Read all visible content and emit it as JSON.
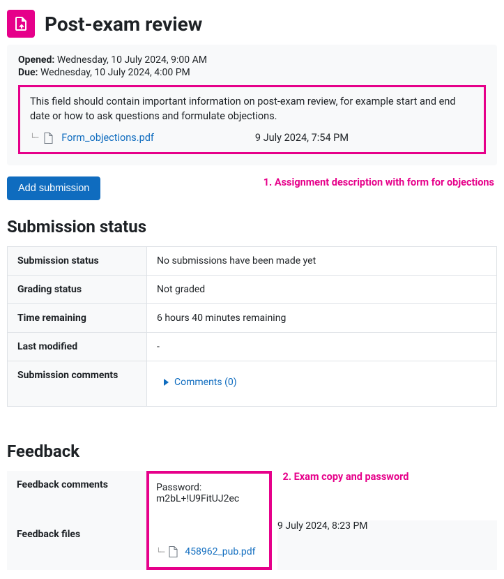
{
  "header": {
    "title": "Post-exam review"
  },
  "dates": {
    "opened_label": "Opened:",
    "opened_value": "Wednesday, 10 July 2024, 9:00 AM",
    "due_label": "Due:",
    "due_value": "Wednesday, 10 July 2024, 4:00 PM"
  },
  "description": {
    "text": "This field should contain important information on post-exam review, for example start and end date or how to ask questions and formulate objections.",
    "file_name": "Form_objections.pdf",
    "file_date": "9 July 2024, 7:54 PM"
  },
  "actions": {
    "add_submission": "Add submission"
  },
  "annotations": {
    "one": "1. Assignment description with form for objections",
    "two": "2. Exam copy and password"
  },
  "status": {
    "heading": "Submission status",
    "rows": {
      "submission_status_label": "Submission status",
      "submission_status_value": "No submissions have been made yet",
      "grading_status_label": "Grading status",
      "grading_status_value": "Not graded",
      "time_remaining_label": "Time remaining",
      "time_remaining_value": "6 hours 40 minutes remaining",
      "last_modified_label": "Last modified",
      "last_modified_value": "-",
      "submission_comments_label": "Submission comments",
      "comments_toggle": "Comments (0)"
    }
  },
  "feedback": {
    "heading": "Feedback",
    "comments_label": "Feedback comments",
    "comments_value": "Password: m2bL+!U9FitUJ2ec",
    "files_label": "Feedback files",
    "file_name": "458962_pub.pdf",
    "file_date": "9 July 2024, 8:23 PM"
  }
}
